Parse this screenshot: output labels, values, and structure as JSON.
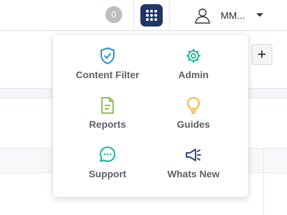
{
  "header": {
    "notification_count": "0",
    "user_name": "MM...",
    "apps_button_color": "#1f3766"
  },
  "toolbar": {
    "add_label": "+"
  },
  "apps_menu": {
    "items": [
      {
        "label": "Content Filter",
        "icon": "shield-check-icon",
        "color": "#1d8fe0"
      },
      {
        "label": "Admin",
        "icon": "gear-icon",
        "color": "#1fb8a1"
      },
      {
        "label": "Reports",
        "icon": "document-icon",
        "color": "#8cc24a"
      },
      {
        "label": "Guides",
        "icon": "lightbulb-icon",
        "color": "#f2b632"
      },
      {
        "label": "Support",
        "icon": "chat-bubble-icon",
        "color": "#13b89a"
      },
      {
        "label": "Whats New",
        "icon": "megaphone-icon",
        "color": "#2d4b7a"
      }
    ]
  }
}
